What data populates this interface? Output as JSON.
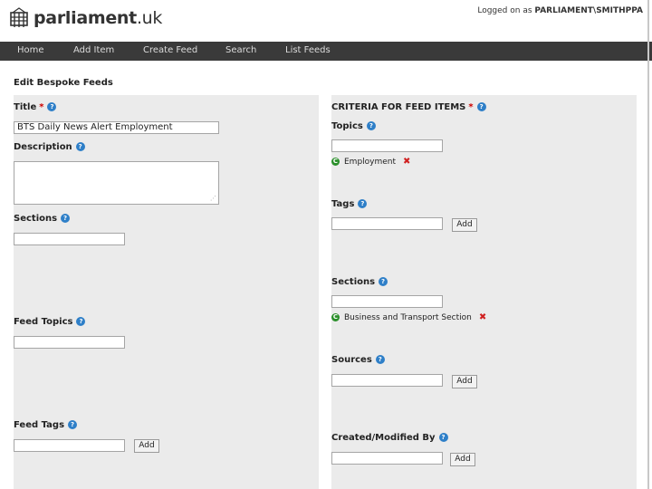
{
  "header": {
    "logo_text": "parliament",
    "logo_suffix": ".uk",
    "login_prefix": "Logged on as",
    "login_user": "PARLIAMENT\\SMITHPPA"
  },
  "nav": [
    "Home",
    "Add Item",
    "Create Feed",
    "Search",
    "List Feeds"
  ],
  "page_title": "Edit Bespoke Feeds",
  "left": {
    "title_label": "Title",
    "title_required": "*",
    "title_value": "BTS Daily News Alert Employment",
    "description_label": "Description",
    "sections_label": "Sections",
    "feed_topics_label": "Feed Topics",
    "feed_tags_label": "Feed Tags",
    "add_label": "Add"
  },
  "right": {
    "criteria_label": "CRITERIA FOR FEED ITEMS",
    "criteria_required": "*",
    "topics_label": "Topics",
    "topic_item": "Employment",
    "tags_label": "Tags",
    "sections_label": "Sections",
    "section_item": "Business and Transport Section",
    "sources_label": "Sources",
    "created_label": "Created/Modified By",
    "add_label": "Add"
  },
  "icons": {
    "help": "?",
    "tag_dot": "C",
    "remove": "✖"
  },
  "colors": {
    "nav_bg": "#3a3a3a",
    "panel_bg": "#ebebeb",
    "help_blue": "#2e7fc8",
    "tag_green": "#2a8f2a",
    "remove_red": "#d02020"
  }
}
